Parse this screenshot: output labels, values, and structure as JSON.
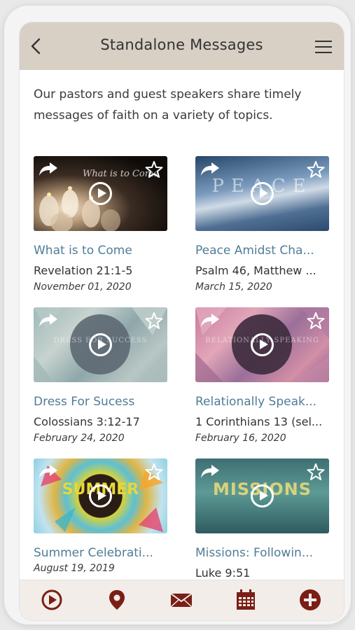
{
  "header": {
    "title": "Standalone Messages",
    "back_icon": "chevron-left-icon",
    "menu_icon": "hamburger-menu-icon"
  },
  "intro": "Our pastors and guest speakers share timely messages of faith on a variety of topics.",
  "messages": [
    {
      "title": "What is to Come",
      "reference": "Revelation 21:1-5",
      "date": "November 01, 2020",
      "thumb_text": "What is to Come"
    },
    {
      "title": "Peace Amidst Cha...",
      "reference": "Psalm 46, Matthew ...",
      "date": "March 15, 2020",
      "thumb_text": "PEACE"
    },
    {
      "title": "Dress For Sucess",
      "reference": "Colossians 3:12-17",
      "date": "February 24, 2020",
      "thumb_text": "DRESS FOR SUCCESS"
    },
    {
      "title": "Relationally Speak...",
      "reference": "1 Corinthians 13 (sel...",
      "date": "February 16, 2020",
      "thumb_text": "RELATIONALLY SPEAKING"
    },
    {
      "title": "Summer Celebrati...",
      "reference": "",
      "date": "August 19, 2019",
      "thumb_text": "SUMMER"
    },
    {
      "title": "Missions: Followin...",
      "reference": "Luke 9:51",
      "date": "",
      "thumb_text": "MISSIONS"
    }
  ],
  "tabbar": {
    "items": [
      "play-circle-icon",
      "map-pin-icon",
      "envelope-icon",
      "calendar-icon",
      "plus-circle-icon"
    ]
  },
  "colors": {
    "header_bg": "#d8cfc5",
    "accent": "#7a1f16",
    "title_link": "#4f7d96"
  }
}
